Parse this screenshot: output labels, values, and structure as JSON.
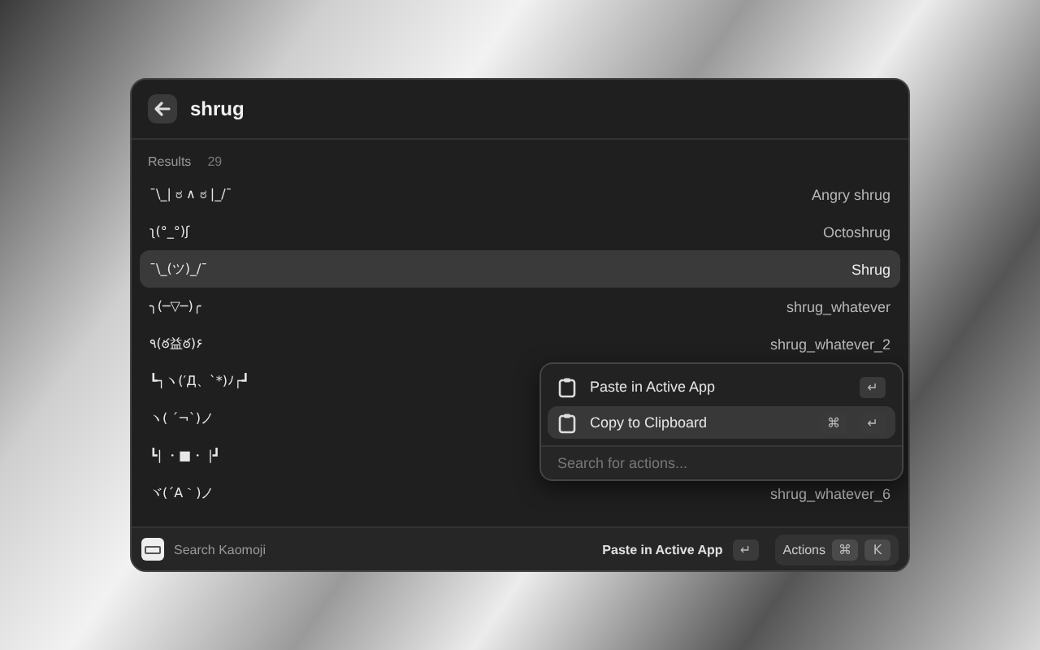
{
  "search": {
    "value": "shrug"
  },
  "results": {
    "label": "Results",
    "count": "29",
    "items": [
      {
        "kaomoji": "¯\\_| ಠ ∧ ಠ |_/¯",
        "name": "Angry shrug",
        "selected": false
      },
      {
        "kaomoji": "ʅ(°_°)ʃ",
        "name": "Octoshrug",
        "selected": false
      },
      {
        "kaomoji": "¯\\_(ツ)_/¯",
        "name": "Shrug",
        "selected": true
      },
      {
        "kaomoji": "╮(─▽─)╭",
        "name": "shrug_whatever",
        "selected": false
      },
      {
        "kaomoji": "٩(ఠ益ఠ)۶",
        "name": "shrug_whatever_2",
        "selected": false
      },
      {
        "kaomoji": "┗┐ヽ(′Д、`*)ﾉ┌┛",
        "selected": false
      },
      {
        "kaomoji": "ヽ( ´¬`)ノ",
        "selected": false
      },
      {
        "kaomoji": "┗| ・■・ |┛",
        "selected": false
      },
      {
        "kaomoji": "ヾ(´A｀)ノ",
        "name": "shrug_whatever_6",
        "selected": false
      }
    ]
  },
  "actions_menu": {
    "items": [
      {
        "label": "Paste in Active App",
        "keys": [
          "↵"
        ],
        "selected": false
      },
      {
        "label": "Copy to Clipboard",
        "keys": [
          "⌘",
          "↵"
        ],
        "selected": true
      }
    ],
    "search": {
      "placeholder": "Search for actions..."
    }
  },
  "footer": {
    "title": "Search Kaomoji",
    "primary_action": "Paste in Active App",
    "primary_key": "↵",
    "actions_label": "Actions",
    "actions_keys": [
      "⌘",
      "K"
    ]
  }
}
